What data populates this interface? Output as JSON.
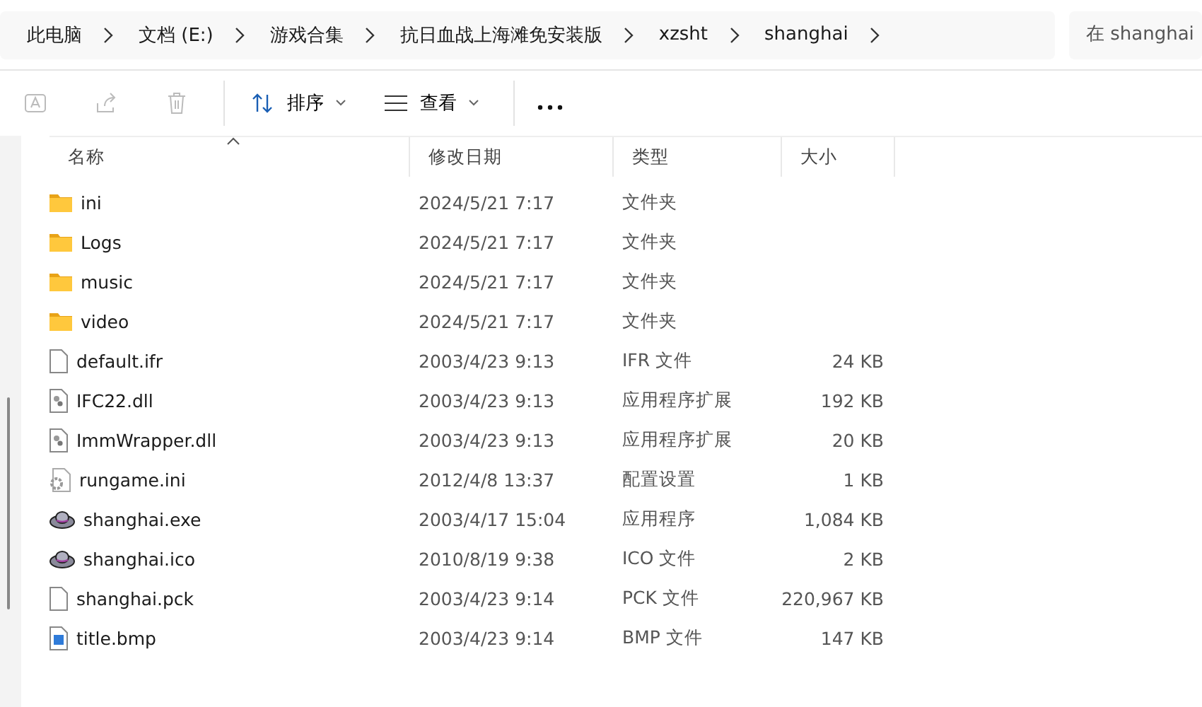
{
  "breadcrumb": [
    "此电脑",
    "文档 (E:)",
    "游戏合集",
    "抗日血战上海滩免安装版",
    "xzsht",
    "shanghai"
  ],
  "search": {
    "placeholder": "在 shanghai"
  },
  "toolbar": {
    "icon_buttons": [
      {
        "kind": "rename",
        "disabled": true
      },
      {
        "kind": "share",
        "disabled": true
      },
      {
        "kind": "delete",
        "disabled": true
      }
    ],
    "sort": "排序",
    "view": "查看"
  },
  "table": {
    "columns": [
      "名称",
      "修改日期",
      "类型",
      "大小"
    ],
    "rows": [
      {
        "kind": "folder",
        "name": "ini",
        "date": "2024/5/21 7:17",
        "type": "文件夹",
        "size": ""
      },
      {
        "kind": "folder",
        "name": "Logs",
        "date": "2024/5/21 7:17",
        "type": "文件夹",
        "size": ""
      },
      {
        "kind": "folder",
        "name": "music",
        "date": "2024/5/21 7:17",
        "type": "文件夹",
        "size": ""
      },
      {
        "kind": "folder",
        "name": "video",
        "date": "2024/5/21 7:17",
        "type": "文件夹",
        "size": ""
      },
      {
        "kind": "file",
        "name": "default.ifr",
        "date": "2003/4/23 9:13",
        "type": "IFR 文件",
        "size": "24 KB"
      },
      {
        "kind": "dll",
        "name": "IFC22.dll",
        "date": "2003/4/23 9:13",
        "type": "应用程序扩展",
        "size": "192 KB"
      },
      {
        "kind": "dll",
        "name": "ImmWrapper.dll",
        "date": "2003/4/23 9:13",
        "type": "应用程序扩展",
        "size": "20 KB"
      },
      {
        "kind": "config",
        "name": "rungame.ini",
        "date": "2012/4/8 13:37",
        "type": "配置设置",
        "size": "1 KB"
      },
      {
        "kind": "hat",
        "name": "shanghai.exe",
        "date": "2003/4/17 15:04",
        "type": "应用程序",
        "size": "1,084 KB"
      },
      {
        "kind": "hat",
        "name": "shanghai.ico",
        "date": "2010/8/19 9:38",
        "type": "ICO 文件",
        "size": "2 KB"
      },
      {
        "kind": "file",
        "name": "shanghai.pck",
        "date": "2003/4/23 9:14",
        "type": "PCK 文件",
        "size": "220,967 KB"
      },
      {
        "kind": "image",
        "name": "title.bmp",
        "date": "2003/4/23 9:14",
        "type": "BMP 文件",
        "size": "147 KB"
      }
    ]
  }
}
